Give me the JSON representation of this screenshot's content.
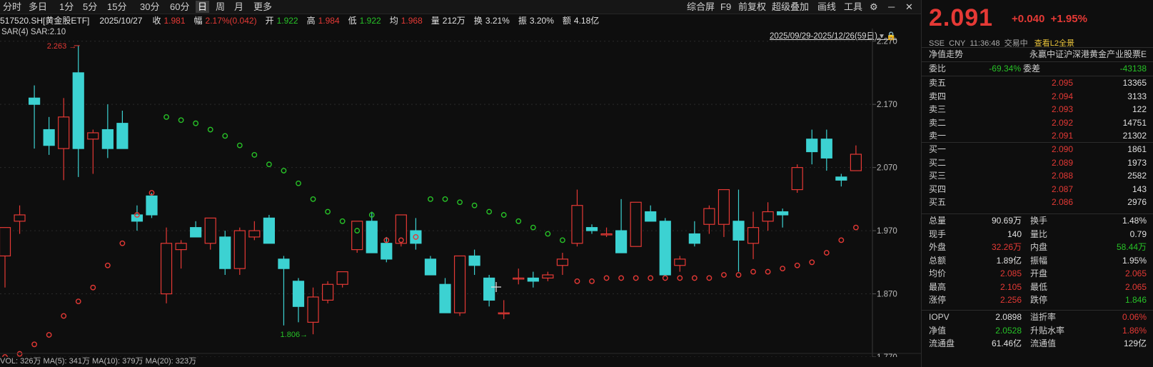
{
  "toolbar": {
    "periods": [
      "分时",
      "多日",
      "1分",
      "5分",
      "15分",
      "30分",
      "60分",
      "日",
      "周",
      "月",
      "更多"
    ],
    "active": "日",
    "right_items": [
      "综合屏",
      "F9",
      "前复权",
      "超级叠加",
      "画线",
      "工具"
    ],
    "gear_icon": "gear-icon",
    "window_controls": [
      "minimize-icon",
      "close-icon"
    ]
  },
  "infobar": {
    "code": "517520.SH[黄金股ETF]",
    "date": "2025/10/27",
    "close_label": "收",
    "close": "1.981",
    "amp_label": "幅",
    "amp": "2.17%(0.042)",
    "open_label": "开",
    "open": "1.922",
    "high_label": "高",
    "high": "1.984",
    "low_label": "低",
    "low": "1.922",
    "avg_label": "均",
    "avg": "1.968",
    "vol_label": "量",
    "vol": "212万",
    "turnover_label": "换",
    "turnover": "3.21%",
    "swing_label": "振",
    "swing": "3.20%",
    "amount_label": "额",
    "amount": "4.18亿"
  },
  "indicator_label": "SAR(4)  SAR:2.10",
  "date_range": "2025/09/29-2025/12/26(59日)",
  "bottom_label": "VOL: 326万  MA(5): 341万  MA(10): 379万  MA(20): 323万",
  "chart_data": {
    "type": "candlestick",
    "ylim": [
      1.77,
      2.29
    ],
    "yticks": [
      "2.270",
      "2.170",
      "2.070",
      "1.970",
      "1.870",
      "1.770"
    ],
    "annotations": [
      {
        "text": "2.263",
        "type": "high-marker"
      },
      {
        "text": "1.806",
        "type": "low-marker"
      }
    ],
    "colors": {
      "up": "#e53935",
      "down": "#3cd2d2",
      "sar_up": "#e53935",
      "sar_down": "#27c227"
    },
    "candles": [
      {
        "o": 1.93,
        "h": 1.975,
        "l": 1.88,
        "c": 1.975
      },
      {
        "o": 1.985,
        "h": 2.01,
        "l": 1.965,
        "c": 1.995
      },
      {
        "o": 2.18,
        "h": 2.2,
        "l": 2.1,
        "c": 2.17
      },
      {
        "o": 2.13,
        "h": 2.15,
        "l": 2.09,
        "c": 2.105
      },
      {
        "o": 2.1,
        "h": 2.18,
        "l": 2.05,
        "c": 2.15
      },
      {
        "o": 2.22,
        "h": 2.263,
        "l": 2.055,
        "c": 2.1
      },
      {
        "o": 2.115,
        "h": 2.13,
        "l": 2.06,
        "c": 2.125
      },
      {
        "o": 2.13,
        "h": 2.17,
        "l": 2.085,
        "c": 2.1
      },
      {
        "o": 2.14,
        "h": 2.16,
        "l": 2.1,
        "c": 2.1
      },
      {
        "o": 1.995,
        "h": 2.01,
        "l": 1.97,
        "c": 1.985
      },
      {
        "o": 2.025,
        "h": 2.03,
        "l": 1.99,
        "c": 1.995
      },
      {
        "o": 1.87,
        "h": 1.975,
        "l": 1.855,
        "c": 1.95
      },
      {
        "o": 1.94,
        "h": 1.955,
        "l": 1.91,
        "c": 1.95
      },
      {
        "o": 1.975,
        "h": 1.985,
        "l": 1.965,
        "c": 1.96
      },
      {
        "o": 1.95,
        "h": 1.99,
        "l": 1.94,
        "c": 1.99
      },
      {
        "o": 1.96,
        "h": 1.97,
        "l": 1.9,
        "c": 1.91
      },
      {
        "o": 1.91,
        "h": 1.975,
        "l": 1.9,
        "c": 1.97
      },
      {
        "o": 1.96,
        "h": 1.985,
        "l": 1.955,
        "c": 1.97
      },
      {
        "o": 1.99,
        "h": 1.995,
        "l": 1.95,
        "c": 1.95
      },
      {
        "o": 1.925,
        "h": 1.93,
        "l": 1.82,
        "c": 1.91
      },
      {
        "o": 1.89,
        "h": 1.895,
        "l": 1.825,
        "c": 1.85
      },
      {
        "o": 1.825,
        "h": 1.88,
        "l": 1.806,
        "c": 1.865
      },
      {
        "o": 1.86,
        "h": 1.89,
        "l": 1.855,
        "c": 1.885
      },
      {
        "o": 1.885,
        "h": 1.905,
        "l": 1.88,
        "c": 1.905
      },
      {
        "o": 1.94,
        "h": 1.985,
        "l": 1.935,
        "c": 1.985
      },
      {
        "o": 1.985,
        "h": 2.0,
        "l": 1.95,
        "c": 1.935
      },
      {
        "o": 1.95,
        "h": 1.96,
        "l": 1.92,
        "c": 1.925
      },
      {
        "o": 1.95,
        "h": 1.995,
        "l": 1.945,
        "c": 1.995
      },
      {
        "o": 1.97,
        "h": 1.99,
        "l": 1.94,
        "c": 1.95
      },
      {
        "o": 1.925,
        "h": 1.93,
        "l": 1.9,
        "c": 1.9
      },
      {
        "o": 1.885,
        "h": 1.895,
        "l": 1.84,
        "c": 1.84
      },
      {
        "o": 1.84,
        "h": 1.93,
        "l": 1.835,
        "c": 1.93
      },
      {
        "o": 1.93,
        "h": 1.94,
        "l": 1.9,
        "c": 1.915
      },
      {
        "o": 1.895,
        "h": 1.9,
        "l": 1.85,
        "c": 1.86
      },
      {
        "o": 1.84,
        "h": 1.86,
        "l": 1.83,
        "c": 1.84
      },
      {
        "o": 1.895,
        "h": 1.91,
        "l": 1.885,
        "c": 1.895
      },
      {
        "o": 1.895,
        "h": 1.905,
        "l": 1.88,
        "c": 1.89
      },
      {
        "o": 1.895,
        "h": 1.905,
        "l": 1.89,
        "c": 1.9
      },
      {
        "o": 1.915,
        "h": 1.935,
        "l": 1.9,
        "c": 1.925
      },
      {
        "o": 1.95,
        "h": 2.035,
        "l": 1.945,
        "c": 2.01
      },
      {
        "o": 1.975,
        "h": 1.98,
        "l": 1.965,
        "c": 1.97
      },
      {
        "o": 1.965,
        "h": 1.975,
        "l": 1.96,
        "c": 1.965
      },
      {
        "o": 1.97,
        "h": 2.02,
        "l": 1.945,
        "c": 1.935
      },
      {
        "o": 1.945,
        "h": 2.015,
        "l": 1.945,
        "c": 2.015
      },
      {
        "o": 2.0,
        "h": 2.01,
        "l": 1.985,
        "c": 1.985
      },
      {
        "o": 1.985,
        "h": 1.99,
        "l": 1.915,
        "c": 1.9
      },
      {
        "o": 1.915,
        "h": 1.93,
        "l": 1.905,
        "c": 1.925
      },
      {
        "o": 1.965,
        "h": 1.985,
        "l": 1.945,
        "c": 1.95
      },
      {
        "o": 1.98,
        "h": 2.01,
        "l": 1.965,
        "c": 2.005
      },
      {
        "o": 1.98,
        "h": 2.035,
        "l": 1.96,
        "c": 2.035
      },
      {
        "o": 1.985,
        "h": 2.035,
        "l": 1.905,
        "c": 1.955
      },
      {
        "o": 1.95,
        "h": 2.0,
        "l": 1.925,
        "c": 1.975
      },
      {
        "o": 1.985,
        "h": 2.015,
        "l": 1.97,
        "c": 2.0
      },
      {
        "o": 2.0,
        "h": 2.005,
        "l": 1.975,
        "c": 1.995
      },
      {
        "o": 2.035,
        "h": 2.075,
        "l": 2.03,
        "c": 2.07
      },
      {
        "o": 2.115,
        "h": 2.13,
        "l": 2.075,
        "c": 2.095
      },
      {
        "o": 2.115,
        "h": 2.13,
        "l": 2.065,
        "c": 2.085
      },
      {
        "o": 2.055,
        "h": 2.06,
        "l": 2.04,
        "c": 2.05
      },
      {
        "o": 2.065,
        "h": 2.105,
        "l": 2.065,
        "c": 2.091
      }
    ],
    "sar": [
      {
        "v": 1.77,
        "t": "up"
      },
      {
        "v": 1.775,
        "t": "up"
      },
      {
        "v": 1.79,
        "t": "up"
      },
      {
        "v": 1.805,
        "t": "up"
      },
      {
        "v": 1.835,
        "t": "up"
      },
      {
        "v": 1.858,
        "t": "up"
      },
      {
        "v": 1.88,
        "t": "up"
      },
      {
        "v": 1.915,
        "t": "up"
      },
      {
        "v": 1.95,
        "t": "up"
      },
      {
        "v": 1.995,
        "t": "up"
      },
      {
        "v": 2.03,
        "t": "up"
      },
      {
        "v": 2.15,
        "t": "down"
      },
      {
        "v": 2.145,
        "t": "down"
      },
      {
        "v": 2.14,
        "t": "down"
      },
      {
        "v": 2.13,
        "t": "down"
      },
      {
        "v": 2.12,
        "t": "down"
      },
      {
        "v": 2.105,
        "t": "down"
      },
      {
        "v": 2.09,
        "t": "down"
      },
      {
        "v": 2.075,
        "t": "down"
      },
      {
        "v": 2.065,
        "t": "down"
      },
      {
        "v": 2.045,
        "t": "down"
      },
      {
        "v": 2.02,
        "t": "down"
      },
      {
        "v": 2.0,
        "t": "down"
      },
      {
        "v": 1.985,
        "t": "down"
      },
      {
        "v": 1.97,
        "t": "down"
      },
      {
        "v": 1.995,
        "t": "down"
      },
      {
        "v": 1.955,
        "t": "up"
      },
      {
        "v": 1.955,
        "t": "up"
      },
      {
        "v": 1.96,
        "t": "up"
      },
      {
        "v": 2.02,
        "t": "down"
      },
      {
        "v": 2.02,
        "t": "down"
      },
      {
        "v": 2.015,
        "t": "down"
      },
      {
        "v": 2.01,
        "t": "down"
      },
      {
        "v": 2.0,
        "t": "down"
      },
      {
        "v": 1.995,
        "t": "down"
      },
      {
        "v": 1.985,
        "t": "down"
      },
      {
        "v": 1.975,
        "t": "down"
      },
      {
        "v": 1.965,
        "t": "down"
      },
      {
        "v": 1.955,
        "t": "down"
      },
      {
        "v": 1.89,
        "t": "up"
      },
      {
        "v": 1.89,
        "t": "up"
      },
      {
        "v": 1.895,
        "t": "up"
      },
      {
        "v": 1.895,
        "t": "up"
      },
      {
        "v": 1.895,
        "t": "up"
      },
      {
        "v": 1.895,
        "t": "up"
      },
      {
        "v": 1.895,
        "t": "up"
      },
      {
        "v": 1.895,
        "t": "up"
      },
      {
        "v": 1.895,
        "t": "up"
      },
      {
        "v": 1.895,
        "t": "up"
      },
      {
        "v": 1.9,
        "t": "up"
      },
      {
        "v": 1.9,
        "t": "up"
      },
      {
        "v": 1.905,
        "t": "up"
      },
      {
        "v": 1.905,
        "t": "up"
      },
      {
        "v": 1.91,
        "t": "up"
      },
      {
        "v": 1.915,
        "t": "up"
      },
      {
        "v": 1.92,
        "t": "up"
      },
      {
        "v": 1.935,
        "t": "up"
      },
      {
        "v": 1.955,
        "t": "up"
      },
      {
        "v": 1.975,
        "t": "up"
      }
    ]
  },
  "quote": {
    "price": "2.091",
    "change": "+0.040",
    "change_pct": "+1.95%",
    "exchange": "SSE",
    "currency": "CNY",
    "time": "11:36:48",
    "status": "交易中",
    "l2_link": "查看L2全景",
    "nav_trend_label": "净值走势",
    "fund_name": "永赢中证沪深港黄金产业股票E",
    "weibi_label": "委比",
    "weibi": "-69.34%",
    "weicha_label": "委差",
    "weicha": "-43138",
    "asks": [
      {
        "label": "卖五",
        "price": "2.095",
        "vol": "13365"
      },
      {
        "label": "卖四",
        "price": "2.094",
        "vol": "3133"
      },
      {
        "label": "卖三",
        "price": "2.093",
        "vol": "122"
      },
      {
        "label": "卖二",
        "price": "2.092",
        "vol": "14751"
      },
      {
        "label": "卖一",
        "price": "2.091",
        "vol": "21302"
      }
    ],
    "bids": [
      {
        "label": "买一",
        "price": "2.090",
        "vol": "1861"
      },
      {
        "label": "买二",
        "price": "2.089",
        "vol": "1973"
      },
      {
        "label": "买三",
        "price": "2.088",
        "vol": "2582"
      },
      {
        "label": "买四",
        "price": "2.087",
        "vol": "143"
      },
      {
        "label": "买五",
        "price": "2.086",
        "vol": "2976"
      }
    ],
    "stats": [
      {
        "l1": "总量",
        "v1": "90.69万",
        "c1": "white",
        "l2": "换手",
        "v2": "1.48%",
        "c2": "white"
      },
      {
        "l1": "现手",
        "v1": "140",
        "c1": "white",
        "l2": "量比",
        "v2": "0.79",
        "c2": "white"
      },
      {
        "l1": "外盘",
        "v1": "32.26万",
        "c1": "red",
        "l2": "内盘",
        "v2": "58.44万",
        "c2": "green"
      },
      {
        "l1": "总额",
        "v1": "1.89亿",
        "c1": "white",
        "l2": "振幅",
        "v2": "1.95%",
        "c2": "white"
      },
      {
        "l1": "均价",
        "v1": "2.085",
        "c1": "red",
        "l2": "开盘",
        "v2": "2.065",
        "c2": "red"
      },
      {
        "l1": "最高",
        "v1": "2.105",
        "c1": "red",
        "l2": "最低",
        "v2": "2.065",
        "c2": "red"
      },
      {
        "l1": "涨停",
        "v1": "2.256",
        "c1": "red",
        "l2": "跌停",
        "v2": "1.846",
        "c2": "green"
      }
    ],
    "stats2": [
      {
        "l1": "IOPV",
        "v1": "2.0898",
        "c1": "white",
        "l2": "溢折率",
        "v2": "0.06%",
        "c2": "red"
      },
      {
        "l1": "净值",
        "v1": "2.0528",
        "c1": "green",
        "l2": "升贴水率",
        "v2": "1.86%",
        "c2": "red"
      },
      {
        "l1": "流通盘",
        "v1": "61.46亿",
        "c1": "white",
        "l2": "流通值",
        "v2": "129亿",
        "c2": "white"
      }
    ]
  }
}
